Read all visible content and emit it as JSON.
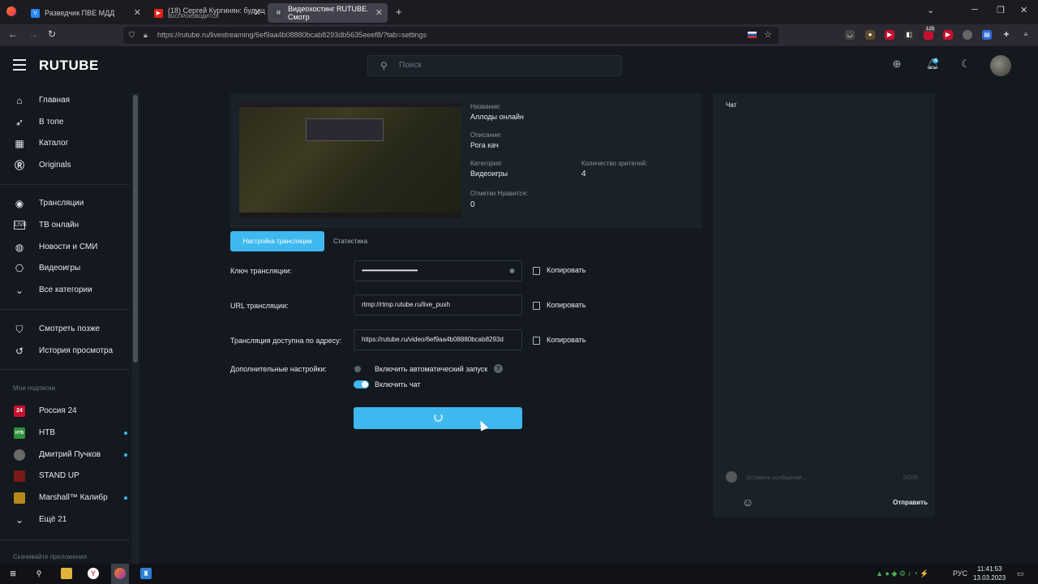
{
  "browser": {
    "tabs": [
      {
        "title": "Разведчик ПВЕ МДД",
        "active": false
      },
      {
        "title": "(18) Сергей Кургинян: будущ",
        "subtitle": "ВОСПРОИЗВОДИТСЯ",
        "active": false
      },
      {
        "title": "Видеохостинг RUTUBE. Смотр",
        "active": true
      }
    ],
    "new_tab": "+",
    "url": "https://rutube.ru/livestreaming/6ef9aa4b08880bcab8293db5635eeef8/?tab=settings",
    "ext_badge": "125"
  },
  "header": {
    "logo": "RUTUBE",
    "search_placeholder": "Поиск",
    "notif_badge": "4"
  },
  "sidebar": {
    "nav": [
      {
        "label": "Главная",
        "icon": "home-icon"
      },
      {
        "label": "В топе",
        "icon": "rocket-icon"
      },
      {
        "label": "Каталог",
        "icon": "grid-icon"
      },
      {
        "label": "Originals",
        "icon": "r-icon"
      }
    ],
    "nav2": [
      {
        "label": "Трансляции",
        "icon": "broadcast-icon"
      },
      {
        "label": "ТВ онлайн",
        "icon": "live-icon"
      },
      {
        "label": "Новости и СМИ",
        "icon": "globe-icon"
      },
      {
        "label": "Видеоигры",
        "icon": "gamepad-icon"
      },
      {
        "label": "Все категории",
        "icon": "chevron-down-icon"
      }
    ],
    "nav3": [
      {
        "label": "Смотреть позже",
        "icon": "bookmark-icon"
      },
      {
        "label": "История просмотра",
        "icon": "history-icon"
      }
    ],
    "subs_title": "Мои подписки",
    "subs": [
      {
        "label": "Россия 24",
        "badge": "24",
        "color": "#c8102e",
        "dot": false
      },
      {
        "label": "НТВ",
        "badge": "НТВ",
        "color": "#2f8f3a",
        "dot": true
      },
      {
        "label": "Дмитрий Пучков",
        "badge": "",
        "color": "#6a6a6a",
        "dot": true
      },
      {
        "label": "STAND UP",
        "badge": "",
        "color": "#7a1a1a",
        "dot": false
      },
      {
        "label": "Marshall™ Калибр",
        "badge": "",
        "color": "#b58a1a",
        "dot": true
      }
    ],
    "more": "Ещё 21",
    "apps_title": "Скачивайте приложения"
  },
  "stream": {
    "name_label": "Название:",
    "name": "Аллоды онлайн",
    "desc_label": "Описание:",
    "desc": "Рога кач",
    "cat_label": "Категория:",
    "cat": "Видеоигры",
    "viewers_label": "Количество зрителей:",
    "viewers": "4",
    "likes_label": "Отметки Нравится:",
    "likes": "0"
  },
  "tabs": {
    "settings": "Настройка трансляции",
    "stats": "Статистика"
  },
  "form": {
    "key_label": "Ключ трансляции:",
    "key_value": "••••••••••••••••••••••••••••••••••••••",
    "url_label": "URL трансляции:",
    "url_value": "rtmp://rtmp.rutube.ru/live_push",
    "addr_label": "Трансляция доступна по адресу:",
    "addr_value": "https://rutube.ru/video/6ef9aa4b08880bcab8293d",
    "copy": "Копировать",
    "extra_label": "Дополнительные настройки:",
    "autostart": "Включить автоматический запуск",
    "autostart_on": false,
    "chat": "Включить чат",
    "chat_on": true,
    "help": "?"
  },
  "chat": {
    "title": "Чат",
    "placeholder": "Оставить сообщение...",
    "counter": "0/200",
    "send": "Отправить"
  },
  "taskbar": {
    "lang": "РУС",
    "time": "11:41:53",
    "date": "13.03.2023"
  },
  "colors": {
    "accent": "#3fb8ef",
    "bg": "#14191f",
    "panel": "#1b2129"
  }
}
